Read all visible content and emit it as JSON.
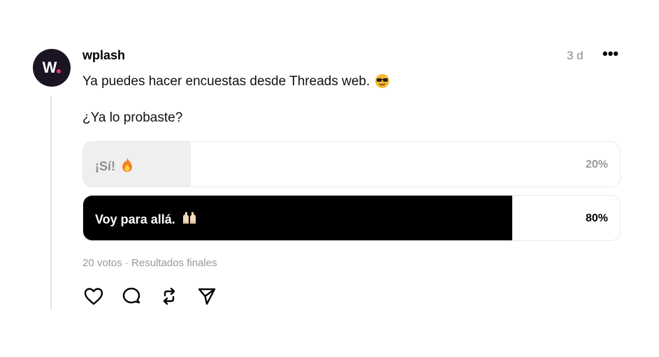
{
  "post": {
    "author": "wplash",
    "time": "3 d",
    "more_label": "•••",
    "text_line1": "Ya puedes hacer encuestas desde Threads web.",
    "text_line2": "¿Ya lo probaste?",
    "line1_emoji": "cool-face-sunglasses-emoji"
  },
  "poll": {
    "options": [
      {
        "label": "¡Sí!",
        "emoji": "fire-emoji",
        "percent_text": "20%",
        "percent": 20
      },
      {
        "label": "Voy para allá.",
        "emoji": "raising-hands-emoji",
        "percent_text": "80%",
        "percent": 80
      }
    ],
    "summary": "20 votos · Resultados finales",
    "colors": {
      "winner": "#000000",
      "other": "#efefef"
    }
  },
  "actions": {
    "like_icon": "heart-icon",
    "reply_icon": "comment-icon",
    "repost_icon": "repost-icon",
    "share_icon": "send-icon"
  }
}
